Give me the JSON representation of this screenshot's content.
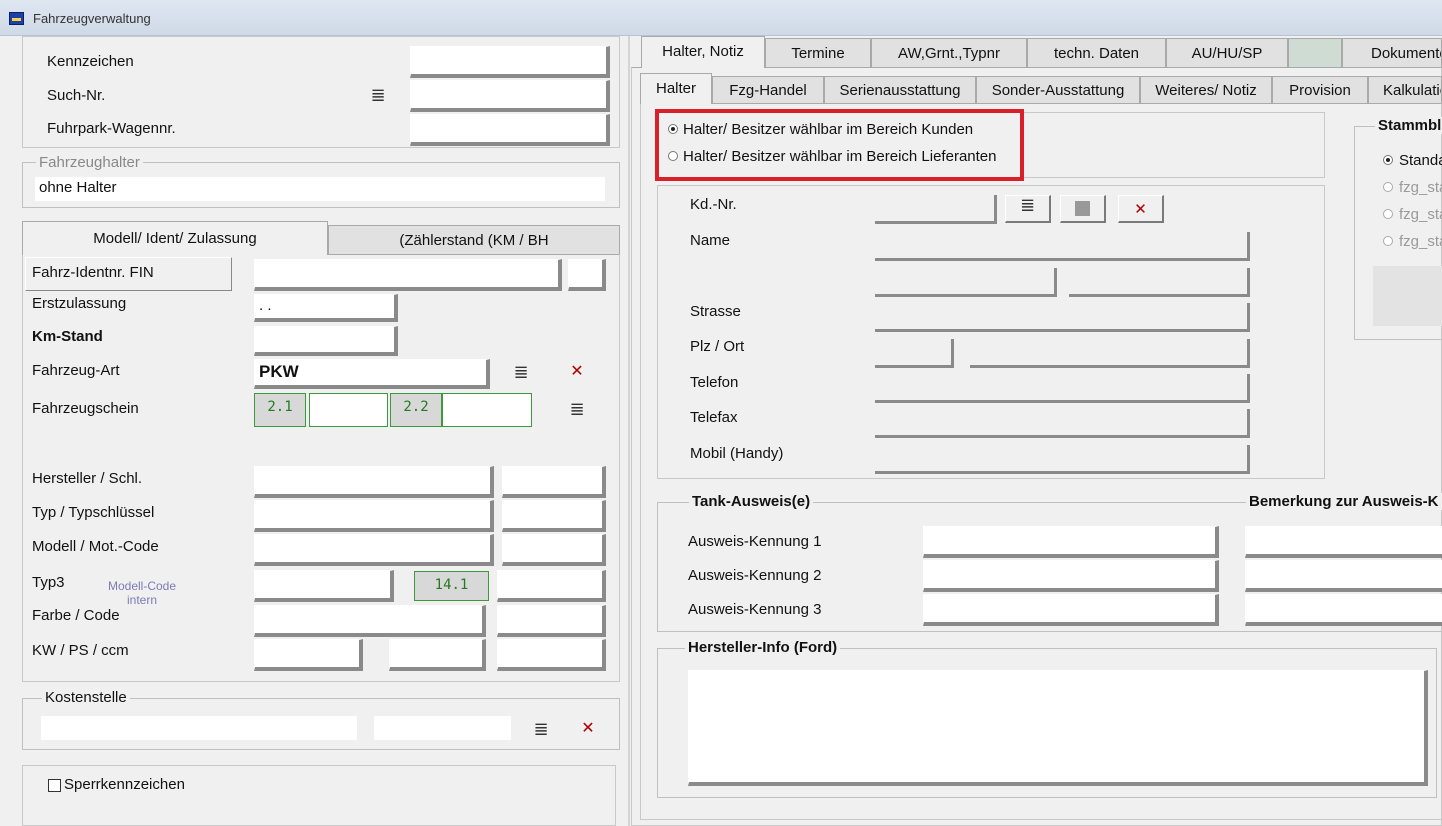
{
  "window": {
    "title": "Fahrzeugverwaltung"
  },
  "left": {
    "top": {
      "kennzeichen_label": "Kennzeichen",
      "suchnr_label": "Such-Nr.",
      "fuhrpark_label": "Fuhrpark-Wagennr."
    },
    "halter": {
      "group_title": "Fahrzeughalter",
      "value": "ohne Halter"
    },
    "tabs": [
      "Modell/ Ident/ Zulassung",
      "(Zählerstand (KM / BH"
    ],
    "fields": {
      "fin_label": "Fahrz-Identnr. FIN",
      "erstzulassung_label": "Erstzulassung",
      "erstzulassung_value": " .  .",
      "kmstand_label": "Km-Stand",
      "fahrzeugart_label": "Fahrzeug-Art",
      "fahrzeugart_value": "PKW",
      "fahrzeugschein_label": "Fahrzeugschein",
      "schein_code1": "2.1",
      "schein_code2": "2.2",
      "hersteller_label": "Hersteller / Schl.",
      "typ_label": "Typ / Typschlüssel",
      "modell_label": "Modell / Mot.-Code",
      "typ3_label": "Typ3",
      "modellcode_hint": "Modell-Code intern",
      "typ3_code": "14.1",
      "farbe_label": "Farbe / Code",
      "kw_label": "KW / PS / ccm"
    },
    "kostenstelle": {
      "group_title": "Kostenstelle"
    },
    "sperr": {
      "label": "Sperrkennzeichen"
    }
  },
  "right": {
    "tabs_top": [
      "Halter, Notiz",
      "Termine",
      "AW,Grnt.,Typnr",
      "techn. Daten",
      "AU/HU/SP",
      "",
      "Dokumente"
    ],
    "tabs_sub": [
      "Halter",
      "Fzg-Handel",
      "Serienausstattung",
      "Sonder-Ausstattung",
      "Weiteres/ Notiz",
      "Provision",
      "Kalkulatio"
    ],
    "radio_kunden": "Halter/ Besitzer wählbar im Bereich Kunden",
    "radio_lieferanten": "Halter/ Besitzer wählbar im Bereich Lieferanten",
    "address": {
      "kdnr_label": "Kd.-Nr.",
      "name_label": "Name",
      "strasse_label": "Strasse",
      "plzort_label": "Plz / Ort",
      "telefon_label": "Telefon",
      "telefax_label": "Telefax",
      "mobil_label": "Mobil (Handy)"
    },
    "tank": {
      "group_title": "Tank-Ausweis(e)",
      "bemerkung_title": "Bemerkung zur Ausweis-K",
      "kennung1": "Ausweis-Kennung 1",
      "kennung2": "Ausweis-Kennung 2",
      "kennung3": "Ausweis-Kennung 3"
    },
    "hersteller_info": {
      "group_title": "Hersteller-Info (Ford)"
    },
    "stammblatt": {
      "group_title": "Stammbl",
      "options": [
        "Standa",
        "fzg_sta",
        "fzg_sta",
        "fzg_sta"
      ]
    }
  },
  "colors": {
    "highlight": "#d9202a",
    "code_green": "#227a22",
    "delete_red": "#b00000"
  }
}
